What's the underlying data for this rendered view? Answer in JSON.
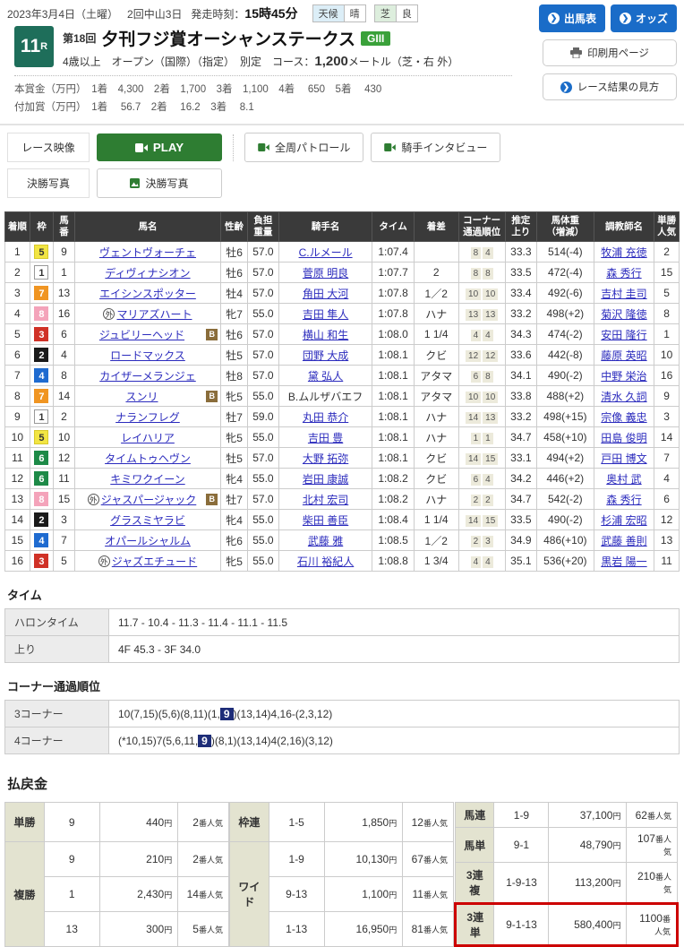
{
  "topbar": {
    "date": "2023年3月4日（土曜）",
    "meeting": "2回中山3日",
    "start_label": "発走時刻：",
    "start_time": "15時45分",
    "weather_key": "天候",
    "weather_val": "晴",
    "turf_key": "芝",
    "turf_val": "良",
    "btn_entry": "出馬表",
    "btn_odds": "オッズ",
    "btn_print": "印刷用ページ",
    "btn_guide": "レース結果の見方"
  },
  "race": {
    "number": "11",
    "number_suffix": "R",
    "kai": "第18回",
    "name": "夕刊フジ賞オーシャンステークス",
    "grade": "GIII",
    "cond_pre": "4歳以上　オープン（国際）（指定）　別定　コース：",
    "cond_dist": "1,200",
    "cond_post": "メートル（芝・右 外）",
    "prize1": "本賞金（万円）　1着　4,300　2着　1,700　3着　1,100　4着　 650　5着　 430",
    "prize2": "付加賞（万円）　1着　 56.7　2着　 16.2　3着　 8.1"
  },
  "media": {
    "label_video": "レース映像",
    "btn_play": "PLAY",
    "btn_patrol": "全周パトロール",
    "btn_interview": "騎手インタビュー",
    "label_photo": "決勝写真",
    "btn_photo": "決勝写真"
  },
  "results": {
    "columns": [
      "着順",
      "枠",
      "馬\n番",
      "馬名",
      "性齢",
      "負担\n重量",
      "騎手名",
      "タイム",
      "着差",
      "コーナー\n通過順位",
      "推定\n上り",
      "馬体重\n（増減）",
      "調教師名",
      "単勝\n人気"
    ],
    "rows": [
      {
        "pos": "1",
        "frame": "5",
        "num": "9",
        "mark": "",
        "horse": "ヴェントヴォーチェ",
        "blinker": false,
        "sexage": "牡6",
        "weight": "57.0",
        "jockey": "C.ルメール",
        "jockey_link": true,
        "time": "1:07.4",
        "margin": "",
        "pass": [
          "8",
          "4"
        ],
        "uprise": "33.3",
        "bodyweight": "514(-4)",
        "trainer": "牧浦 充徳",
        "fav": "2"
      },
      {
        "pos": "2",
        "frame": "1",
        "num": "1",
        "mark": "",
        "horse": "ディヴィナシオン",
        "blinker": false,
        "sexage": "牡6",
        "weight": "57.0",
        "jockey": "菅原 明良",
        "jockey_link": true,
        "time": "1:07.7",
        "margin": "2",
        "pass": [
          "8",
          "8"
        ],
        "uprise": "33.5",
        "bodyweight": "472(-4)",
        "trainer": "森 秀行",
        "fav": "15"
      },
      {
        "pos": "3",
        "frame": "7",
        "num": "13",
        "mark": "",
        "horse": "エイシンスポッター",
        "blinker": false,
        "sexage": "牡4",
        "weight": "57.0",
        "jockey": "角田 大河",
        "jockey_link": true,
        "time": "1:07.8",
        "margin": "1／2",
        "pass": [
          "10",
          "10"
        ],
        "uprise": "33.4",
        "bodyweight": "492(-6)",
        "trainer": "吉村 圭司",
        "fav": "5"
      },
      {
        "pos": "4",
        "frame": "8",
        "num": "16",
        "mark": "外",
        "horse": "マリアズハート",
        "blinker": false,
        "sexage": "牝7",
        "weight": "55.0",
        "jockey": "吉田 隼人",
        "jockey_link": true,
        "time": "1:07.8",
        "margin": "ハナ",
        "pass": [
          "13",
          "13"
        ],
        "uprise": "33.2",
        "bodyweight": "498(+2)",
        "trainer": "菊沢 隆徳",
        "fav": "8"
      },
      {
        "pos": "5",
        "frame": "3",
        "num": "6",
        "mark": "",
        "horse": "ジュビリーヘッド",
        "blinker": true,
        "sexage": "牡6",
        "weight": "57.0",
        "jockey": "横山 和生",
        "jockey_link": true,
        "time": "1:08.0",
        "margin": "1 1/4",
        "pass": [
          "4",
          "4"
        ],
        "uprise": "34.3",
        "bodyweight": "474(-2)",
        "trainer": "安田 隆行",
        "fav": "1"
      },
      {
        "pos": "6",
        "frame": "2",
        "num": "4",
        "mark": "",
        "horse": "ロードマックス",
        "blinker": false,
        "sexage": "牡5",
        "weight": "57.0",
        "jockey": "団野 大成",
        "jockey_link": true,
        "time": "1:08.1",
        "margin": "クビ",
        "pass": [
          "12",
          "12"
        ],
        "uprise": "33.6",
        "bodyweight": "442(-8)",
        "trainer": "藤原 英昭",
        "fav": "10"
      },
      {
        "pos": "7",
        "frame": "4",
        "num": "8",
        "mark": "",
        "horse": "カイザーメランジェ",
        "blinker": false,
        "sexage": "牡8",
        "weight": "57.0",
        "jockey": "黛 弘人",
        "jockey_link": true,
        "time": "1:08.1",
        "margin": "アタマ",
        "pass": [
          "6",
          "8"
        ],
        "uprise": "34.1",
        "bodyweight": "490(-2)",
        "trainer": "中野 栄治",
        "fav": "16"
      },
      {
        "pos": "8",
        "frame": "7",
        "num": "14",
        "mark": "",
        "horse": "スンリ",
        "blinker": true,
        "sexage": "牝5",
        "weight": "55.0",
        "jockey": "B.ムルザバエフ",
        "jockey_link": false,
        "time": "1:08.1",
        "margin": "アタマ",
        "pass": [
          "10",
          "10"
        ],
        "uprise": "33.8",
        "bodyweight": "488(+2)",
        "trainer": "清水 久詞",
        "fav": "9"
      },
      {
        "pos": "9",
        "frame": "1",
        "num": "2",
        "mark": "",
        "horse": "ナランフレグ",
        "blinker": false,
        "sexage": "牡7",
        "weight": "59.0",
        "jockey": "丸田 恭介",
        "jockey_link": true,
        "time": "1:08.1",
        "margin": "ハナ",
        "pass": [
          "14",
          "13"
        ],
        "uprise": "33.2",
        "bodyweight": "498(+15)",
        "trainer": "宗像 義忠",
        "fav": "3"
      },
      {
        "pos": "10",
        "frame": "5",
        "num": "10",
        "mark": "",
        "horse": "レイハリア",
        "blinker": false,
        "sexage": "牝5",
        "weight": "55.0",
        "jockey": "吉田 豊",
        "jockey_link": true,
        "time": "1:08.1",
        "margin": "ハナ",
        "pass": [
          "1",
          "1"
        ],
        "uprise": "34.7",
        "bodyweight": "458(+10)",
        "trainer": "田島 俊明",
        "fav": "14"
      },
      {
        "pos": "11",
        "frame": "6",
        "num": "12",
        "mark": "",
        "horse": "タイムトゥヘヴン",
        "blinker": false,
        "sexage": "牡5",
        "weight": "57.0",
        "jockey": "大野 拓弥",
        "jockey_link": true,
        "time": "1:08.1",
        "margin": "クビ",
        "pass": [
          "14",
          "15"
        ],
        "uprise": "33.1",
        "bodyweight": "494(+2)",
        "trainer": "戸田 博文",
        "fav": "7"
      },
      {
        "pos": "12",
        "frame": "6",
        "num": "11",
        "mark": "",
        "horse": "キミワクイーン",
        "blinker": false,
        "sexage": "牝4",
        "weight": "55.0",
        "jockey": "岩田 康誠",
        "jockey_link": true,
        "time": "1:08.2",
        "margin": "クビ",
        "pass": [
          "6",
          "4"
        ],
        "uprise": "34.2",
        "bodyweight": "446(+2)",
        "trainer": "奥村 武",
        "fav": "4"
      },
      {
        "pos": "13",
        "frame": "8",
        "num": "15",
        "mark": "外",
        "horse": "ジャスパージャック",
        "blinker": true,
        "sexage": "牡7",
        "weight": "57.0",
        "jockey": "北村 宏司",
        "jockey_link": true,
        "time": "1:08.2",
        "margin": "ハナ",
        "pass": [
          "2",
          "2"
        ],
        "uprise": "34.7",
        "bodyweight": "542(-2)",
        "trainer": "森 秀行",
        "fav": "6"
      },
      {
        "pos": "14",
        "frame": "2",
        "num": "3",
        "mark": "",
        "horse": "グラスミヤラビ",
        "blinker": false,
        "sexage": "牝4",
        "weight": "55.0",
        "jockey": "柴田 善臣",
        "jockey_link": true,
        "time": "1:08.4",
        "margin": "1 1/4",
        "pass": [
          "14",
          "15"
        ],
        "uprise": "33.5",
        "bodyweight": "490(-2)",
        "trainer": "杉浦 宏昭",
        "fav": "12"
      },
      {
        "pos": "15",
        "frame": "4",
        "num": "7",
        "mark": "",
        "horse": "オパールシャルム",
        "blinker": false,
        "sexage": "牝6",
        "weight": "55.0",
        "jockey": "武藤 雅",
        "jockey_link": true,
        "time": "1:08.5",
        "margin": "1／2",
        "pass": [
          "2",
          "3"
        ],
        "uprise": "34.9",
        "bodyweight": "486(+10)",
        "trainer": "武藤 善則",
        "fav": "13"
      },
      {
        "pos": "16",
        "frame": "3",
        "num": "5",
        "mark": "外",
        "horse": "ジャズエチュード",
        "blinker": false,
        "sexage": "牝5",
        "weight": "55.0",
        "jockey": "石川 裕紀人",
        "jockey_link": true,
        "time": "1:08.8",
        "margin": "1 3/4",
        "pass": [
          "4",
          "4"
        ],
        "uprise": "35.1",
        "bodyweight": "536(+20)",
        "trainer": "黒岩 陽一",
        "fav": "11"
      }
    ]
  },
  "frame_colors": {
    "1": {
      "bg": "#ffffff",
      "fg": "#333333",
      "border": "#999999"
    },
    "2": {
      "bg": "#1a1a1a",
      "fg": "#ffffff",
      "border": "#1a1a1a"
    },
    "3": {
      "bg": "#d03126",
      "fg": "#ffffff",
      "border": "#d03126"
    },
    "4": {
      "bg": "#1f6bd0",
      "fg": "#ffffff",
      "border": "#1f6bd0"
    },
    "5": {
      "bg": "#f2e543",
      "fg": "#333333",
      "border": "#d8c92c"
    },
    "6": {
      "bg": "#1d8a47",
      "fg": "#ffffff",
      "border": "#1d8a47"
    },
    "7": {
      "bg": "#f09522",
      "fg": "#ffffff",
      "border": "#f09522"
    },
    "8": {
      "bg": "#f4a3ba",
      "fg": "#ffffff",
      "border": "#f4a3ba"
    }
  },
  "time_section": {
    "heading": "タイム",
    "rows": [
      {
        "label": "ハロンタイム",
        "value": "11.7 - 10.4 - 11.3 - 11.4 - 11.1 - 11.5"
      },
      {
        "label": "上り",
        "value": "4F 45.3 - 3F 34.0"
      }
    ]
  },
  "corner_section": {
    "heading": "コーナー通過順位",
    "rows": [
      {
        "label": "3コーナー",
        "parts": [
          "10(7,15)(5,6)(8,11)(1,",
          "9",
          ")(13,14)4,16-(2,3,12)"
        ]
      },
      {
        "label": "4コーナー",
        "parts": [
          "(*10,15)7(5,6,11,",
          "9",
          ")(8,1)(13,14)4(2,16)(3,12)"
        ]
      }
    ]
  },
  "payout": {
    "heading": "払戻金",
    "yen": "円",
    "fav_suffix": "番人気",
    "groups": [
      [
        {
          "label": "単勝",
          "rows": [
            {
              "combo": "9",
              "amount": "440",
              "fav": "2"
            }
          ]
        },
        {
          "label": "複勝",
          "rows": [
            {
              "combo": "9",
              "amount": "210",
              "fav": "2"
            },
            {
              "combo": "1",
              "amount": "2,430",
              "fav": "14"
            },
            {
              "combo": "13",
              "amount": "300",
              "fav": "5"
            }
          ]
        }
      ],
      [
        {
          "label": "枠連",
          "rows": [
            {
              "combo": "1-5",
              "amount": "1,850",
              "fav": "12"
            }
          ]
        },
        {
          "label": "ワイド",
          "rows": [
            {
              "combo": "1-9",
              "amount": "10,130",
              "fav": "67"
            },
            {
              "combo": "9-13",
              "amount": "1,100",
              "fav": "11"
            },
            {
              "combo": "1-13",
              "amount": "16,950",
              "fav": "81"
            }
          ]
        }
      ],
      [
        {
          "label": "馬連",
          "rows": [
            {
              "combo": "1-9",
              "amount": "37,100",
              "fav": "62"
            }
          ]
        },
        {
          "label": "馬単",
          "rows": [
            {
              "combo": "9-1",
              "amount": "48,790",
              "fav": "107"
            }
          ]
        },
        {
          "label": "3連複",
          "rows": [
            {
              "combo": "1-9-13",
              "amount": "113,200",
              "fav": "210"
            }
          ]
        },
        {
          "label": "3連単",
          "highlight": true,
          "rows": [
            {
              "combo": "9-1-13",
              "amount": "580,400",
              "fav": "1100"
            }
          ]
        }
      ]
    ]
  }
}
